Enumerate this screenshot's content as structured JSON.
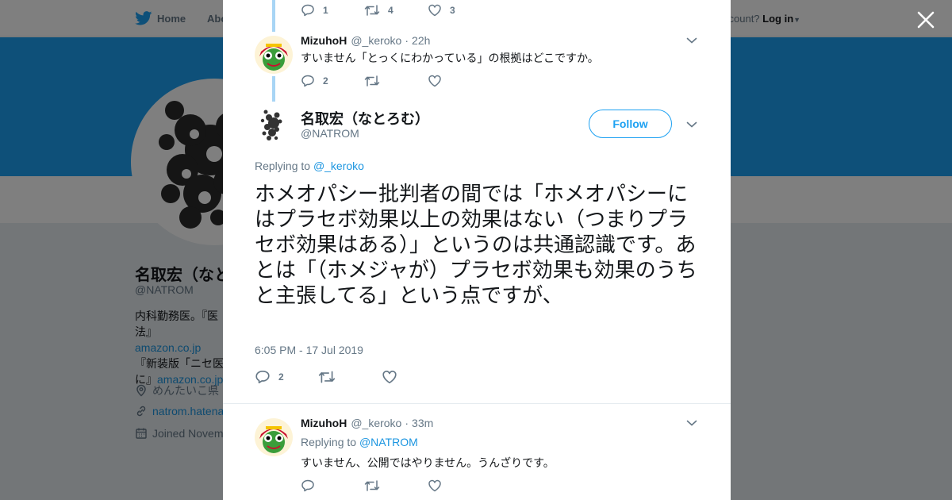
{
  "nav": {
    "home": "Home",
    "about": "Abo",
    "login_prefix": "ccount?",
    "login": "Log in"
  },
  "background_profile": {
    "name": "名取宏（なと",
    "handle": "@NATROM",
    "bio_line1": "内科勤務医。『医",
    "bio_line2_prefix": "法』",
    "bio_line2_link": "amazon.co.jp",
    "bio_line3": "『新装版「ニセ医",
    "bio_line4_prefix": "に』",
    "bio_line4_link": "amazon.co.jp",
    "location": "めんたいこ県",
    "website": "natrom.hatena",
    "joined": "Joined Novem"
  },
  "colors": {
    "brand": "#1da1f2",
    "link": "#1b95e0",
    "thread_line": "#a8d5f5"
  },
  "prev_tweet_actions": {
    "reply_count": "1",
    "retweet_count": "4",
    "like_count": "3"
  },
  "reply_tweet_1": {
    "name": "MizuhoH",
    "handle": "@_keroko",
    "time": "22h",
    "text": "すいません「とっくにわかっている」の根拠はどこですか。",
    "reply_count": "2",
    "retweet_count": "",
    "like_count": ""
  },
  "main_tweet": {
    "name": "名取宏（なとろむ）",
    "handle": "@NATROM",
    "follow_label": "Follow",
    "replying_label": "Replying to",
    "replying_to": "@_keroko",
    "text": "ホメオパシー批判者の間では「ホメオパシーにはプラセボ効果以上の効果はない（つまりプラセボ効果はある）」というのは共通認識です。あとは「（ホメジャが）プラセボ効果も効果のうちと主張してる」という点ですが、",
    "timestamp": "6:05 PM - 17 Jul 2019",
    "reply_count": "2",
    "retweet_count": "",
    "like_count": ""
  },
  "reply_tweet_2": {
    "name": "MizuhoH",
    "handle": "@_keroko",
    "time": "33m",
    "replying_label": "Replying to",
    "replying_to": "@NATROM",
    "text": "すいません、公開ではやりません。うんざりです。",
    "reply_count": "",
    "retweet_count": "",
    "like_count": ""
  },
  "icons": [
    "twitter-bird-icon",
    "close-icon",
    "reply-icon",
    "retweet-icon",
    "like-icon",
    "chevron-down-icon",
    "location-icon",
    "link-icon",
    "calendar-icon"
  ]
}
